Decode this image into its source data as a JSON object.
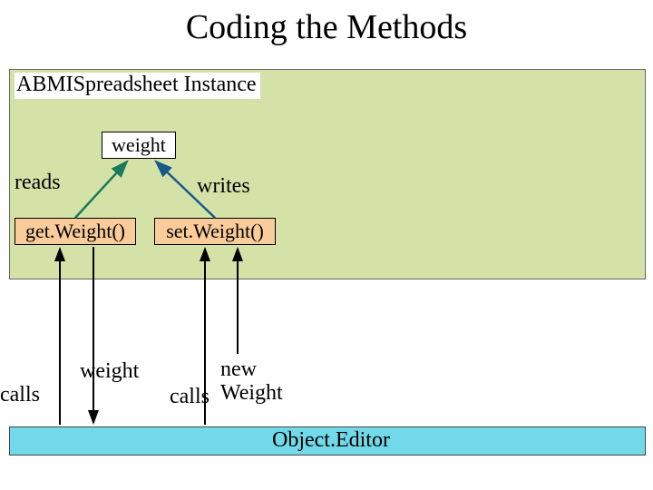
{
  "title": "Coding the Methods",
  "instance_label": "ABMISpreadsheet Instance",
  "weight_field": "weight",
  "reads": "reads",
  "writes": "writes",
  "get_method": "get.Weight()",
  "set_method": "set.Weight()",
  "calls_left": "calls",
  "return_label": "weight",
  "calls_mid": "calls",
  "new_weight_l1": "new",
  "new_weight_l2": "Weight",
  "object_editor": "Object.Editor",
  "colors": {
    "instance_bg": "#d4e2a8",
    "method_bg": "#f9cc99",
    "editor_bg": "#71d9e8",
    "arrow_reads": "#1a7a5a",
    "arrow_writes": "#1a5a8a"
  }
}
